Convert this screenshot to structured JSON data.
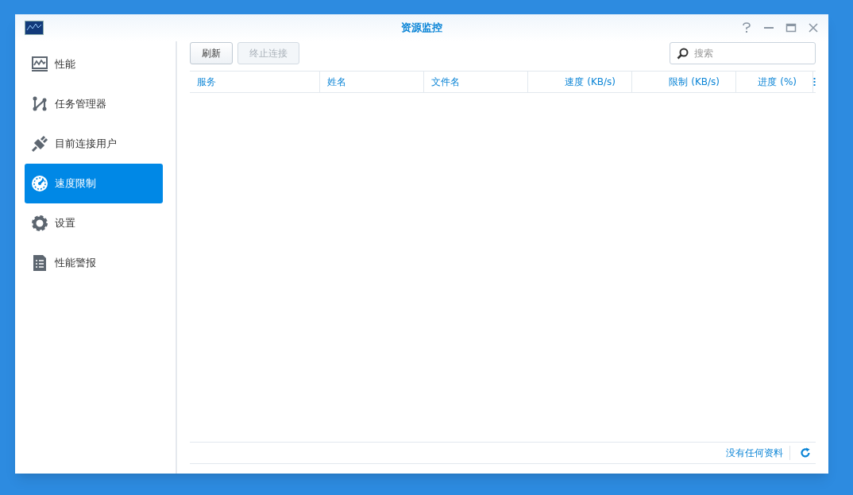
{
  "window": {
    "title": "资源监控"
  },
  "sidebar": {
    "items": [
      {
        "label": "性能",
        "selected": false
      },
      {
        "label": "任务管理器",
        "selected": false
      },
      {
        "label": "目前连接用户",
        "selected": false
      },
      {
        "label": "速度限制",
        "selected": true
      },
      {
        "label": "设置",
        "selected": false
      },
      {
        "label": "性能警报",
        "selected": false
      }
    ]
  },
  "toolbar": {
    "buttons": [
      {
        "label": "刷新",
        "disabled": false
      },
      {
        "label": "终止连接",
        "disabled": true
      }
    ],
    "search": {
      "placeholder": "搜索"
    }
  },
  "table": {
    "columns": [
      {
        "label": "服务"
      },
      {
        "label": "姓名"
      },
      {
        "label": "文件名"
      },
      {
        "label": "速度 (KB/s)"
      },
      {
        "label": "限制 (KB/s)"
      },
      {
        "label": "进度 (%)"
      }
    ]
  },
  "status_bar": {
    "text": "没有任何资料"
  }
}
